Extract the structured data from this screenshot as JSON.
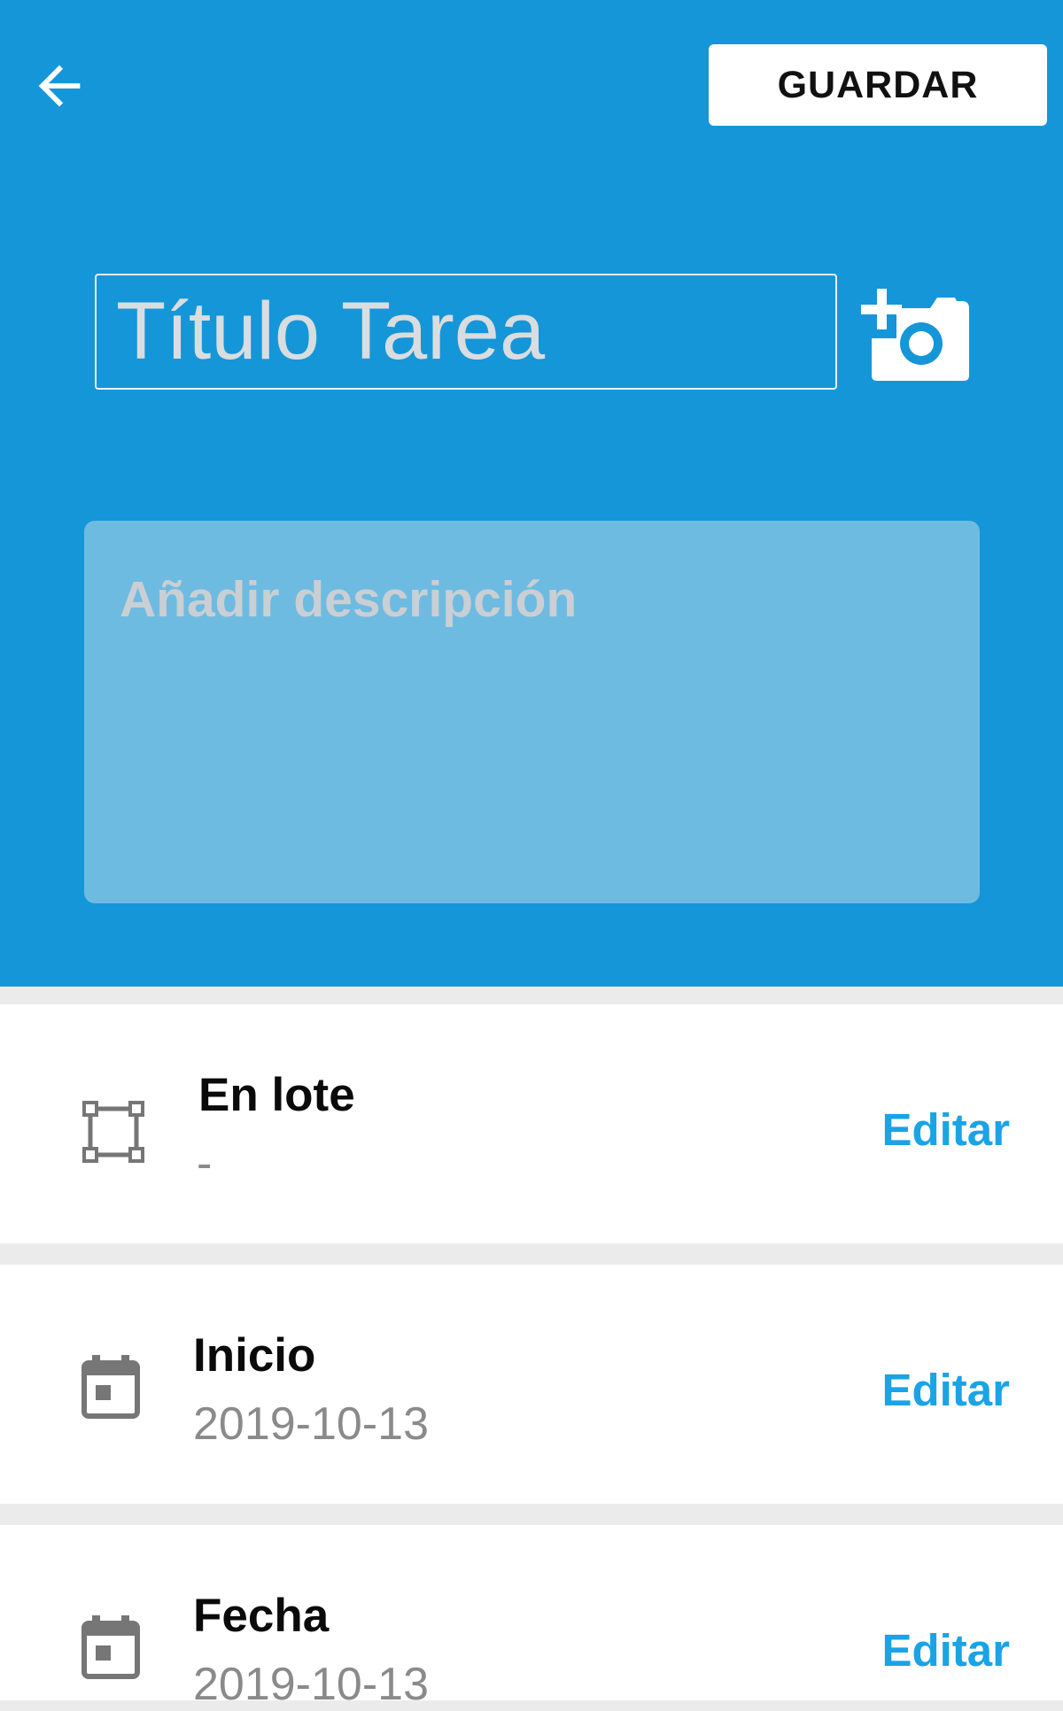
{
  "header": {
    "save_label": "GUARDAR",
    "title_placeholder": "Título Tarea",
    "description_placeholder": "Añadir descripción",
    "background_color": "#1596d8",
    "back_icon": "arrow-back-icon",
    "camera_icon": "add-photo-icon"
  },
  "rows": [
    {
      "icon": "select-area-icon",
      "title": "En lote",
      "value": "-",
      "action": "Editar"
    },
    {
      "icon": "calendar-icon",
      "title": "Inicio",
      "value": "2019-10-13",
      "action": "Editar"
    },
    {
      "icon": "calendar-icon",
      "title": "Fecha",
      "value": "2019-10-13",
      "action": "Editar"
    }
  ],
  "colors": {
    "accent": "#1aa3e6",
    "title_text": "#0a0a0a",
    "value_text": "#8a8a8a",
    "separator": "#ebebeb"
  }
}
